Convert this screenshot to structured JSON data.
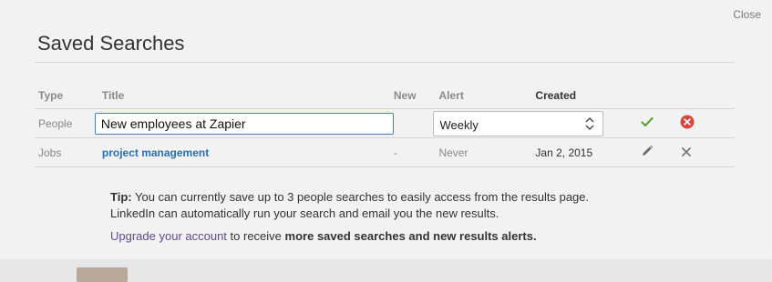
{
  "dialog": {
    "title": "Saved Searches",
    "close_label": "Close"
  },
  "table": {
    "headers": {
      "type": "Type",
      "title": "Title",
      "new": "New",
      "alert": "Alert",
      "created": "Created"
    },
    "rows": [
      {
        "type": "People",
        "title": "New employees at Zapier",
        "new": "",
        "alert": "Weekly",
        "created": "",
        "editing": true,
        "actions": [
          "confirm-check-icon",
          "cancel-circle-x-icon"
        ]
      },
      {
        "type": "Jobs",
        "title": "project management",
        "new": "-",
        "alert": "Never",
        "created": "Jan 2, 2015",
        "editing": false,
        "actions": [
          "edit-pencil-icon",
          "delete-x-icon"
        ]
      }
    ]
  },
  "alert_options": [
    "Weekly"
  ],
  "tip": {
    "label": "Tip:",
    "line1": "You can currently save up to 3 people searches to easily access from the results page.",
    "line2": "LinkedIn can automatically run your search and email you the new results."
  },
  "upgrade": {
    "link": "Upgrade your account",
    "middle": "to receive",
    "bold": "more saved searches and new results alerts."
  },
  "colors": {
    "link_blue": "#2a6fae",
    "check_green": "#5fa33a",
    "cancel_red": "#d9453a",
    "upgrade_purple": "#5f4b8b",
    "input_focus_border": "#4a7fb0"
  }
}
